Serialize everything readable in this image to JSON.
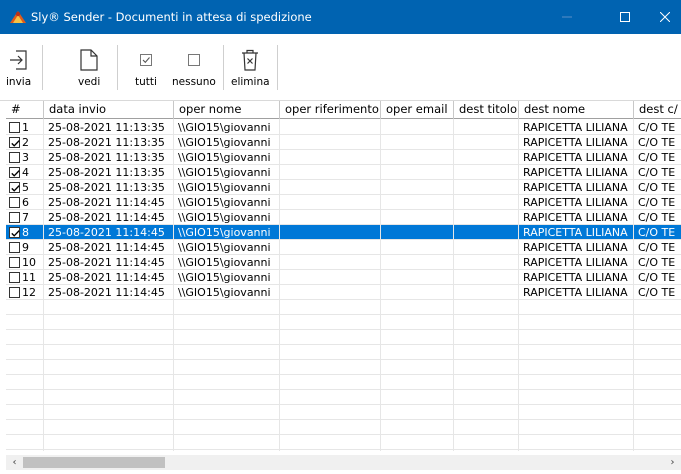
{
  "window": {
    "title": "Sly® Sender - Documenti in attesa di spedizione",
    "minimize_icon": "minimize-icon",
    "maximize_icon": "maximize-icon",
    "close_icon": "close-icon",
    "title_bar_color": "#0063b1"
  },
  "toolbar": {
    "invia": "invia",
    "vedi": "vedi",
    "tutti": "tutti",
    "nessuno": "nessuno",
    "elimina": "elimina"
  },
  "grid": {
    "columns": [
      "#",
      "data invio",
      "oper nome",
      "oper riferimento",
      "oper email",
      "dest titolo",
      "dest nome",
      "dest c/"
    ],
    "selection_color": "#0078d7",
    "rows": [
      {
        "n": "1",
        "checked": false,
        "selected": false,
        "data_invio": "25-08-2021 11:13:35",
        "oper_nome": "\\\\GIO15\\giovanni",
        "oper_riferimento": "",
        "oper_email": "",
        "dest_titolo": "",
        "dest_nome": "RAPICETTA LILIANA",
        "dest_c": "C/O TE"
      },
      {
        "n": "2",
        "checked": true,
        "selected": false,
        "data_invio": "25-08-2021 11:13:35",
        "oper_nome": "\\\\GIO15\\giovanni",
        "oper_riferimento": "",
        "oper_email": "",
        "dest_titolo": "",
        "dest_nome": "RAPICETTA LILIANA",
        "dest_c": "C/O TE"
      },
      {
        "n": "3",
        "checked": false,
        "selected": false,
        "data_invio": "25-08-2021 11:13:35",
        "oper_nome": "\\\\GIO15\\giovanni",
        "oper_riferimento": "",
        "oper_email": "",
        "dest_titolo": "",
        "dest_nome": "RAPICETTA LILIANA",
        "dest_c": "C/O TE"
      },
      {
        "n": "4",
        "checked": true,
        "selected": false,
        "data_invio": "25-08-2021 11:13:35",
        "oper_nome": "\\\\GIO15\\giovanni",
        "oper_riferimento": "",
        "oper_email": "",
        "dest_titolo": "",
        "dest_nome": "RAPICETTA LILIANA",
        "dest_c": "C/O TE"
      },
      {
        "n": "5",
        "checked": true,
        "selected": false,
        "data_invio": "25-08-2021 11:13:35",
        "oper_nome": "\\\\GIO15\\giovanni",
        "oper_riferimento": "",
        "oper_email": "",
        "dest_titolo": "",
        "dest_nome": "RAPICETTA LILIANA",
        "dest_c": "C/O TE"
      },
      {
        "n": "6",
        "checked": false,
        "selected": false,
        "data_invio": "25-08-2021 11:14:45",
        "oper_nome": "\\\\GIO15\\giovanni",
        "oper_riferimento": "",
        "oper_email": "",
        "dest_titolo": "",
        "dest_nome": "RAPICETTA LILIANA",
        "dest_c": "C/O TE"
      },
      {
        "n": "7",
        "checked": false,
        "selected": false,
        "data_invio": "25-08-2021 11:14:45",
        "oper_nome": "\\\\GIO15\\giovanni",
        "oper_riferimento": "",
        "oper_email": "",
        "dest_titolo": "",
        "dest_nome": "RAPICETTA LILIANA",
        "dest_c": "C/O TE"
      },
      {
        "n": "8",
        "checked": true,
        "selected": true,
        "data_invio": "25-08-2021 11:14:45",
        "oper_nome": "\\\\GIO15\\giovanni",
        "oper_riferimento": "",
        "oper_email": "",
        "dest_titolo": "",
        "dest_nome": "RAPICETTA LILIANA",
        "dest_c": "C/O TE"
      },
      {
        "n": "9",
        "checked": false,
        "selected": false,
        "data_invio": "25-08-2021 11:14:45",
        "oper_nome": "\\\\GIO15\\giovanni",
        "oper_riferimento": "",
        "oper_email": "",
        "dest_titolo": "",
        "dest_nome": "RAPICETTA LILIANA",
        "dest_c": "C/O TE"
      },
      {
        "n": "10",
        "checked": false,
        "selected": false,
        "data_invio": "25-08-2021 11:14:45",
        "oper_nome": "\\\\GIO15\\giovanni",
        "oper_riferimento": "",
        "oper_email": "",
        "dest_titolo": "",
        "dest_nome": "RAPICETTA LILIANA",
        "dest_c": "C/O TE"
      },
      {
        "n": "11",
        "checked": false,
        "selected": false,
        "data_invio": "25-08-2021 11:14:45",
        "oper_nome": "\\\\GIO15\\giovanni",
        "oper_riferimento": "",
        "oper_email": "",
        "dest_titolo": "",
        "dest_nome": "RAPICETTA LILIANA",
        "dest_c": "C/O TE"
      },
      {
        "n": "12",
        "checked": false,
        "selected": false,
        "data_invio": "25-08-2021 11:14:45",
        "oper_nome": "\\\\GIO15\\giovanni",
        "oper_riferimento": "",
        "oper_email": "",
        "dest_titolo": "",
        "dest_nome": "RAPICETTA LILIANA",
        "dest_c": "C/O TE"
      }
    ]
  },
  "scrollbar": {
    "left_arrow": "‹",
    "right_arrow": "›"
  }
}
